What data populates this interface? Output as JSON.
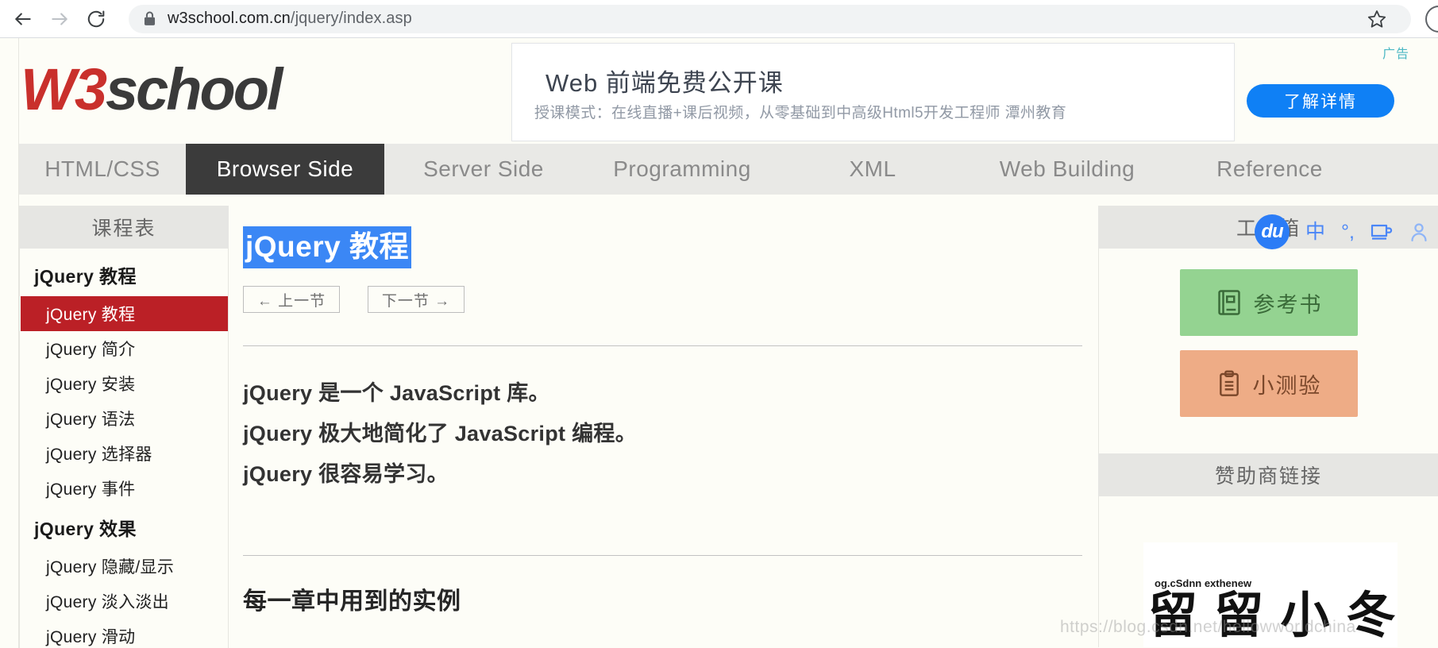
{
  "browser": {
    "back_icon": "back-arrow-icon",
    "forward_icon": "forward-arrow-icon",
    "reload_icon": "reload-icon",
    "lock_icon": "lock-icon",
    "url_host": "w3school.com.cn",
    "url_path": "/jquery/index.asp",
    "url_full": "w3school.com.cn/jquery/index.asp",
    "bookmark_icon": "star-outline-icon",
    "profile_icon": "profile-avatar-icon"
  },
  "site": {
    "logo_w3": "W3",
    "logo_school": "school"
  },
  "ad": {
    "label": "广告",
    "title": "Web 前端免费公开课",
    "subtitle": "授课模式：在线直播+课后视频，从零基础到中高级Html5开发工程师 潭州教育",
    "cta_label": "了解详情",
    "cta_color": "#0f80f5",
    "label_color": "#4bb8c4"
  },
  "nav": {
    "tabs": [
      {
        "label": "HTML/CSS",
        "active": false
      },
      {
        "label": "Browser Side",
        "active": true
      },
      {
        "label": "Server Side",
        "active": false
      },
      {
        "label": "Programming",
        "active": false
      },
      {
        "label": "XML",
        "active": false
      },
      {
        "label": "Web Building",
        "active": false
      },
      {
        "label": "Reference",
        "active": false
      }
    ],
    "active_bg": "#3b3b3b",
    "bar_bg": "#e9e9e6"
  },
  "sidebar": {
    "title": "课程表",
    "items": [
      {
        "label": "jQuery 教程",
        "type": "group"
      },
      {
        "label": "jQuery 教程",
        "type": "link",
        "active": true
      },
      {
        "label": "jQuery 简介",
        "type": "link",
        "active": false
      },
      {
        "label": "jQuery 安装",
        "type": "link",
        "active": false
      },
      {
        "label": "jQuery 语法",
        "type": "link",
        "active": false
      },
      {
        "label": "jQuery 选择器",
        "type": "link",
        "active": false
      },
      {
        "label": "jQuery 事件",
        "type": "link",
        "active": false
      },
      {
        "label": "jQuery 效果",
        "type": "group"
      },
      {
        "label": "jQuery 隐藏/显示",
        "type": "link",
        "active": false
      },
      {
        "label": "jQuery 淡入淡出",
        "type": "link",
        "active": false
      },
      {
        "label": "jQuery 滑动",
        "type": "link",
        "active": false
      }
    ],
    "active_color": "#bb2026"
  },
  "article": {
    "title": "jQuery 教程",
    "title_selected": true,
    "selection_color": "#3b87f5",
    "prev_label": "← 上一节",
    "next_label": "下一节 →",
    "paragraphs": [
      "jQuery 是一个 JavaScript 库。",
      "jQuery 极大地简化了 JavaScript 编程。",
      "jQuery 很容易学习。"
    ],
    "section_heading": "每一章中用到的实例"
  },
  "toolbox": {
    "title": "工具箱",
    "cards": [
      {
        "label": "参考书",
        "icon": "book-icon",
        "bg": "#94d391",
        "fg": "#3a6b39"
      },
      {
        "label": "小测验",
        "icon": "clipboard-icon",
        "bg": "#eeac86",
        "fg": "#7a472a"
      }
    ]
  },
  "sponsor": {
    "title": "赞助商链接",
    "banner_small_text": "og.cSdnn  exthenew",
    "banner_glyphs": "留 留 小 冬"
  },
  "baidu_toolbar": {
    "logo": "du",
    "icons": [
      {
        "name": "chinese-input-icon",
        "glyph": "中"
      },
      {
        "name": "punctuation-icon",
        "glyph": "°,"
      },
      {
        "name": "soft-keyboard-icon",
        "glyph": "▭"
      },
      {
        "name": "person-icon",
        "glyph": "◍"
      }
    ]
  },
  "watermark": {
    "text": "https://blog.csdn.net/hellowworldchina"
  }
}
